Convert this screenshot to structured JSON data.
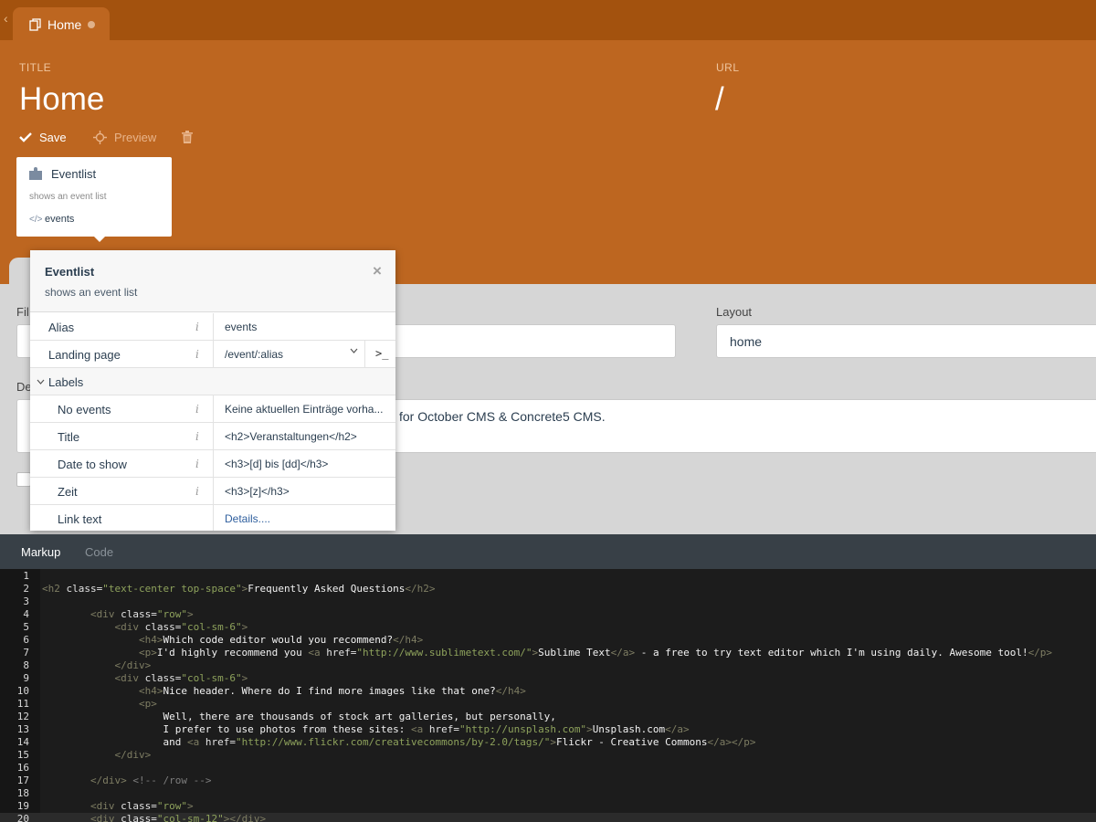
{
  "tabs": {
    "back_glyph": "‹",
    "home_tab": {
      "label": "Home",
      "icon": "pages-icon"
    }
  },
  "header": {
    "title_caption": "TITLE",
    "title_value": "Home",
    "url_caption": "URL",
    "url_value": "/",
    "toolbar": {
      "save_label": "Save",
      "preview_label": "Preview"
    }
  },
  "component": {
    "name": "Eventlist",
    "description": "shows an event list",
    "alias": "events",
    "icon": "puzzle-icon"
  },
  "form": {
    "file_label": "Fil",
    "layout_label": "Layout",
    "layout_value": "home",
    "description_label": "De",
    "description_value": "for October CMS & Concrete5 CMS."
  },
  "inspector": {
    "title": "Eventlist",
    "description": "shows an event list",
    "close_glyph": "×",
    "info_glyph": "i",
    "alias": {
      "label": "Alias",
      "value": "events"
    },
    "landing_page": {
      "label": "Landing page",
      "value": "/event/:alias",
      "terminal_glyph": ">_"
    },
    "labels_group": "Labels",
    "no_events": {
      "label": "No events",
      "value": "Keine aktuellen Einträge vorha..."
    },
    "title_row": {
      "label": "Title",
      "value": "<h2>Veranstaltungen</h2>"
    },
    "date_row": {
      "label": "Date to show",
      "value": "<h3>[d] bis [dd]</h3>"
    },
    "zeit_row": {
      "label": "Zeit",
      "value": "<h3>[z]</h3>"
    },
    "link_row": {
      "label": "Link text",
      "value": "Details...."
    }
  },
  "editor": {
    "tabs": {
      "markup": "Markup",
      "code": "Code"
    },
    "lines": [
      [],
      [
        [
          "t",
          "<h2 "
        ],
        [
          "a",
          "class="
        ],
        [
          "s",
          "\"text-center top-space\""
        ],
        [
          "t",
          ">"
        ],
        [
          "p",
          "Frequently Asked Questions"
        ],
        [
          "t",
          "</h2>"
        ]
      ],
      [],
      [
        [
          "p",
          "        "
        ],
        [
          "t",
          "<div "
        ],
        [
          "a",
          "class="
        ],
        [
          "s",
          "\"row\""
        ],
        [
          "t",
          ">"
        ]
      ],
      [
        [
          "p",
          "            "
        ],
        [
          "t",
          "<div "
        ],
        [
          "a",
          "class="
        ],
        [
          "s",
          "\"col-sm-6\""
        ],
        [
          "t",
          ">"
        ]
      ],
      [
        [
          "p",
          "                "
        ],
        [
          "t",
          "<h4>"
        ],
        [
          "p",
          "Which code editor would you recommend?"
        ],
        [
          "t",
          "</h4>"
        ]
      ],
      [
        [
          "p",
          "                "
        ],
        [
          "t",
          "<p>"
        ],
        [
          "p",
          "I'd highly recommend you "
        ],
        [
          "t",
          "<a "
        ],
        [
          "a",
          "href="
        ],
        [
          "s",
          "\"http://www.sublimetext.com/\""
        ],
        [
          "t",
          ">"
        ],
        [
          "p",
          "Sublime Text"
        ],
        [
          "t",
          "</a>"
        ],
        [
          "p",
          " - a free to try text editor which I'm using daily. Awesome tool!"
        ],
        [
          "t",
          "</p>"
        ]
      ],
      [
        [
          "p",
          "            "
        ],
        [
          "t",
          "</div>"
        ]
      ],
      [
        [
          "p",
          "            "
        ],
        [
          "t",
          "<div "
        ],
        [
          "a",
          "class="
        ],
        [
          "s",
          "\"col-sm-6\""
        ],
        [
          "t",
          ">"
        ]
      ],
      [
        [
          "p",
          "                "
        ],
        [
          "t",
          "<h4>"
        ],
        [
          "p",
          "Nice header. Where do I find more images like that one?"
        ],
        [
          "t",
          "</h4>"
        ]
      ],
      [
        [
          "p",
          "                "
        ],
        [
          "t",
          "<p>"
        ]
      ],
      [
        [
          "p",
          "                    Well, there are thousands of stock art galleries, but personally,"
        ]
      ],
      [
        [
          "p",
          "                    I prefer to use photos from these sites: "
        ],
        [
          "t",
          "<a "
        ],
        [
          "a",
          "href="
        ],
        [
          "s",
          "\"http://unsplash.com\""
        ],
        [
          "t",
          ">"
        ],
        [
          "p",
          "Unsplash.com"
        ],
        [
          "t",
          "</a>"
        ]
      ],
      [
        [
          "p",
          "                    and "
        ],
        [
          "t",
          "<a "
        ],
        [
          "a",
          "href="
        ],
        [
          "s",
          "\"http://www.flickr.com/creativecommons/by-2.0/tags/\""
        ],
        [
          "t",
          ">"
        ],
        [
          "p",
          "Flickr - Creative Commons"
        ],
        [
          "t",
          "</a></p>"
        ]
      ],
      [
        [
          "p",
          "            "
        ],
        [
          "t",
          "</div>"
        ]
      ],
      [],
      [
        [
          "p",
          "        "
        ],
        [
          "t",
          "</div>"
        ],
        [
          "c",
          " <!-- /row -->"
        ]
      ],
      [],
      [
        [
          "p",
          "        "
        ],
        [
          "t",
          "<div "
        ],
        [
          "a",
          "class="
        ],
        [
          "s",
          "\"row\""
        ],
        [
          "t",
          ">"
        ]
      ],
      [
        [
          "p",
          "        "
        ],
        [
          "t",
          "<div "
        ],
        [
          "a",
          "class="
        ],
        [
          "s",
          "\"col-sm-12\""
        ],
        [
          "t",
          "></div>"
        ]
      ]
    ]
  }
}
